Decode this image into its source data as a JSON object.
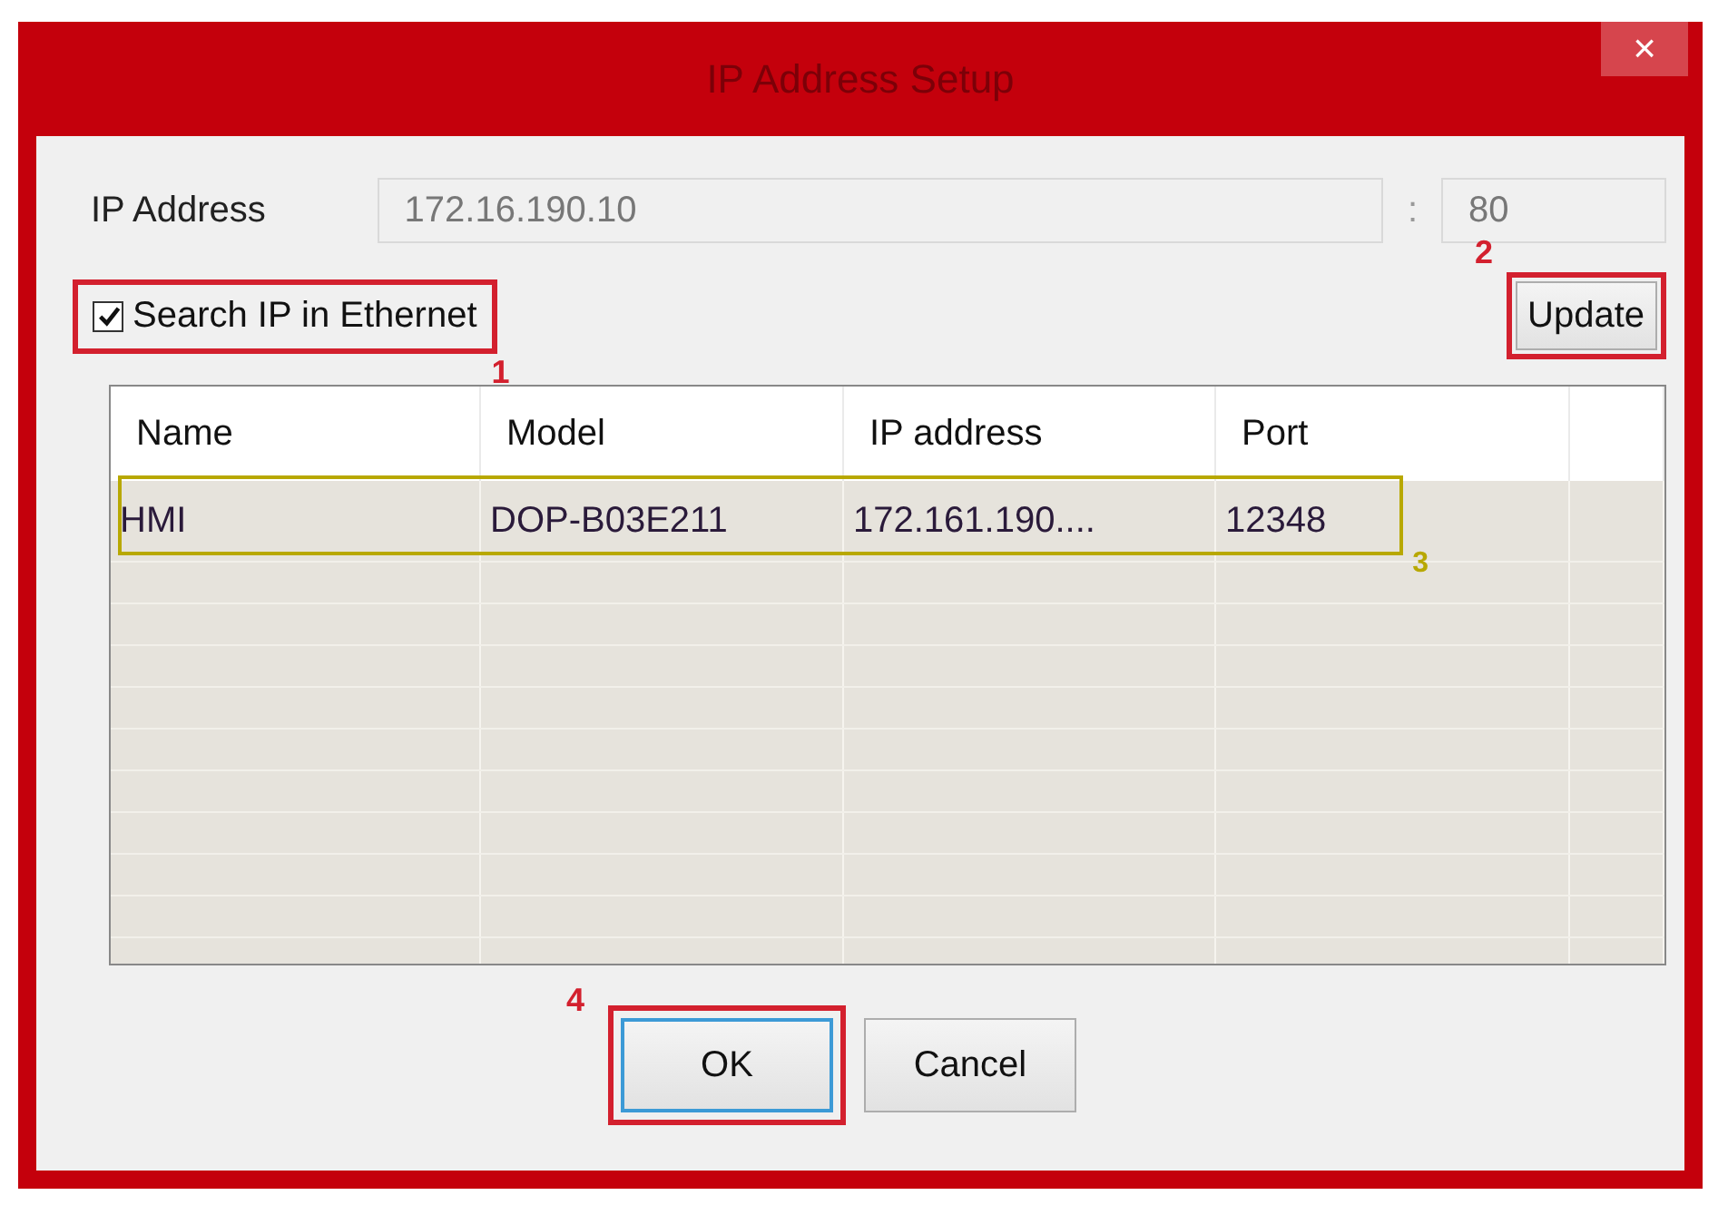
{
  "window": {
    "title": "IP Address Setup",
    "close": "×"
  },
  "ip_address": {
    "label": "IP Address",
    "value": "172.16.190.10"
  },
  "port": {
    "separator": ":",
    "value": "80"
  },
  "search_checkbox": {
    "label": "Search IP in Ethernet",
    "checked": true,
    "callout": {
      "number": "1",
      "color": "#d3202e"
    }
  },
  "update_button": {
    "label": "Update",
    "callout": {
      "number": "2",
      "color": "#d3202e"
    }
  },
  "table": {
    "columns": [
      "Name",
      "Model",
      "IP address",
      "Port"
    ],
    "rows": [
      {
        "cells": [
          "HMI",
          "DOP-B03E211",
          "172.161.190....",
          "12348"
        ],
        "callout": {
          "number": "3",
          "color": "#b8a800"
        }
      }
    ]
  },
  "buttons": [
    {
      "label": "OK",
      "default": true,
      "callout": {
        "number": "4",
        "color": "#d3202e"
      }
    },
    {
      "label": "Cancel",
      "default": false
    }
  ]
}
